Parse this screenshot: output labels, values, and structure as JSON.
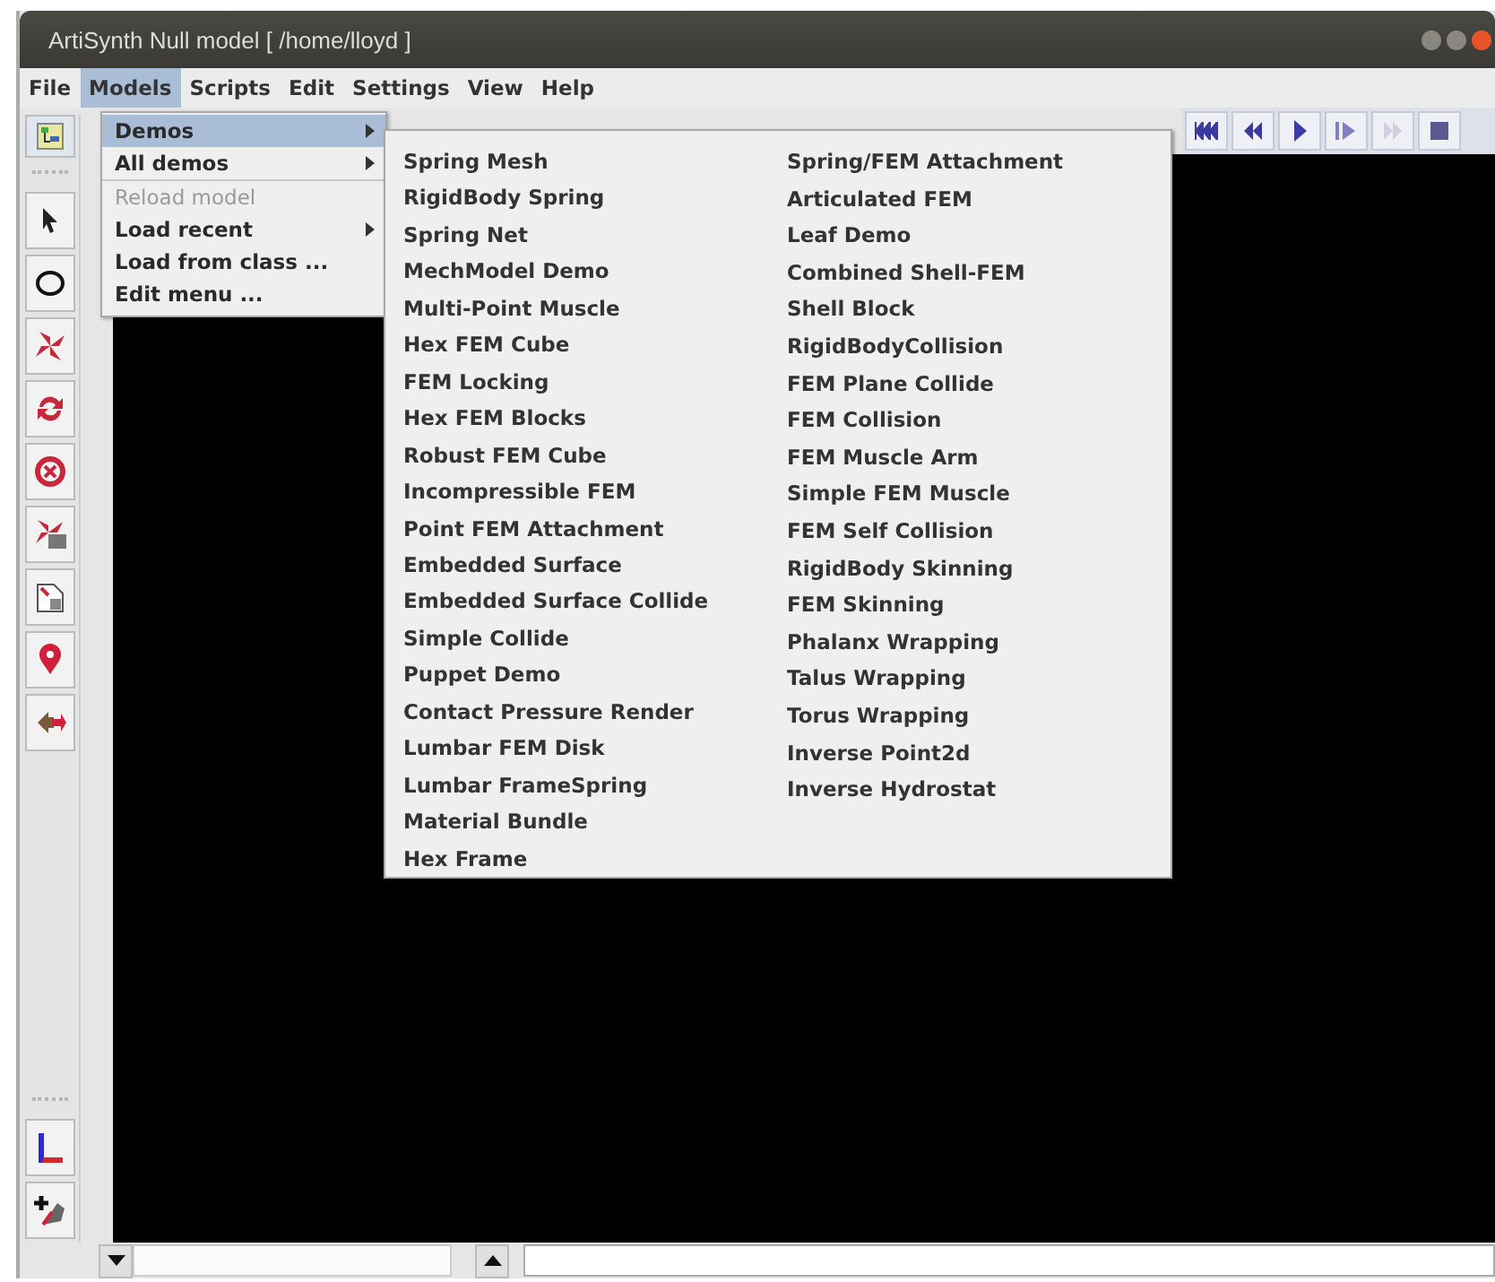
{
  "window": {
    "title": "ArtiSynth Null model [ /home/lloyd ]"
  },
  "menubar": {
    "items": [
      {
        "label": "File",
        "selected": false
      },
      {
        "label": "Models",
        "selected": true
      },
      {
        "label": "Scripts",
        "selected": false
      },
      {
        "label": "Edit",
        "selected": false
      },
      {
        "label": "Settings",
        "selected": false
      },
      {
        "label": "View",
        "selected": false
      },
      {
        "label": "Help",
        "selected": false
      }
    ]
  },
  "models_menu": {
    "items": [
      {
        "label": "Demos",
        "kind": "submenu",
        "selected": true,
        "disabled": false
      },
      {
        "label": "All demos",
        "kind": "submenu",
        "selected": false,
        "disabled": false
      },
      {
        "label": "Reload model",
        "kind": "item",
        "selected": false,
        "disabled": true
      },
      {
        "label": "Load recent",
        "kind": "submenu",
        "selected": false,
        "disabled": false
      },
      {
        "label": "Load from class ...",
        "kind": "item",
        "selected": false,
        "disabled": false
      },
      {
        "label": "Edit menu ...",
        "kind": "item",
        "selected": false,
        "disabled": false
      }
    ]
  },
  "demos_submenu": {
    "columns": [
      [
        "Spring Mesh",
        "RigidBody Spring",
        "Spring Net",
        "MechModel Demo",
        "Multi-Point Muscle",
        "Hex FEM Cube",
        "FEM Locking",
        "Hex FEM Blocks",
        "Robust FEM Cube",
        "Incompressible FEM",
        "Point FEM Attachment",
        "Embedded Surface",
        "Embedded Surface Collide",
        "Simple Collide",
        "Puppet Demo",
        "Contact Pressure Render",
        "Lumbar FEM Disk",
        "Lumbar FrameSpring",
        "Material Bundle",
        "Hex Frame"
      ],
      [
        "Spring/FEM Attachment",
        "Articulated FEM",
        "Leaf Demo",
        "Combined Shell-FEM",
        "Shell Block",
        "RigidBodyCollision",
        "FEM Plane Collide",
        "FEM Collision",
        "FEM Muscle Arm",
        "Simple FEM Muscle",
        "FEM Self Collision",
        "RigidBody Skinning",
        "FEM Skinning",
        "Phalanx Wrapping",
        "Talus Wrapping",
        "Torus Wrapping",
        "Inverse Point2d",
        "Inverse Hydrostat"
      ]
    ]
  }
}
